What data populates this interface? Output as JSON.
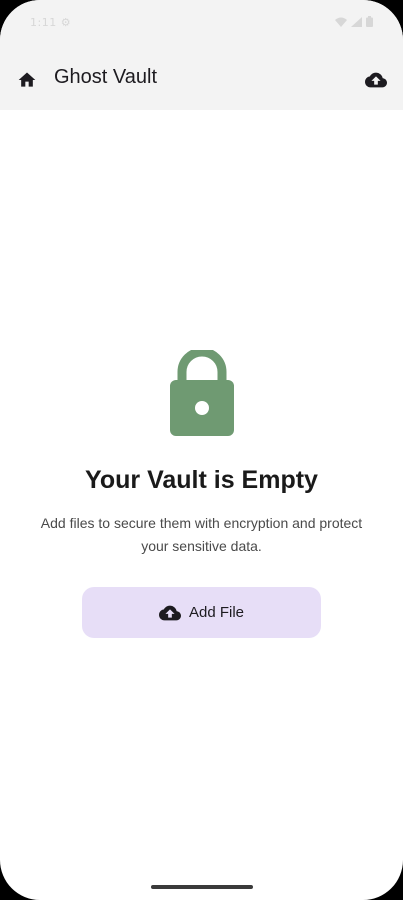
{
  "status_bar": {
    "left_text": "1:11 ⚙",
    "icons": [
      "wifi-icon",
      "signal-icon",
      "battery-icon"
    ]
  },
  "app_bar": {
    "title": "Ghost Vault",
    "left_icon": "home-icon",
    "right_icon": "cloud-upload-icon"
  },
  "empty_state": {
    "icon": "lock-icon",
    "icon_color": "#6f9a72",
    "title": "Your Vault is Empty",
    "description": "Add files to secure them with encryption and protect your sensitive data."
  },
  "add_file_button": {
    "label": "Add File",
    "icon": "cloud-upload-icon",
    "background": "#e7def7"
  }
}
